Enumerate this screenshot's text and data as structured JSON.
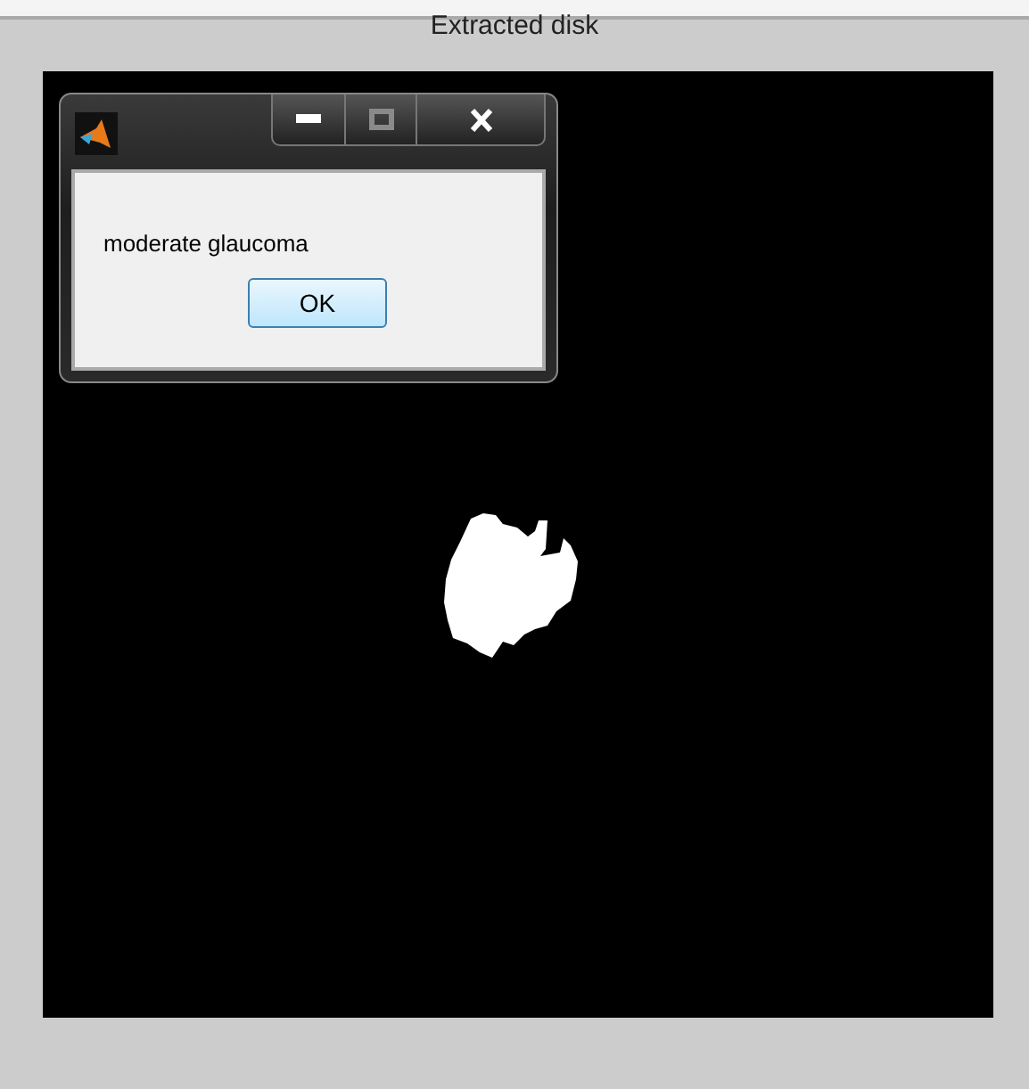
{
  "figure": {
    "title": "Extracted disk"
  },
  "dialog": {
    "message": "moderate glaucoma",
    "ok_button": "OK",
    "title_buttons": [
      {
        "kind": "minimize",
        "disabled": false
      },
      {
        "kind": "maximize",
        "disabled": true
      },
      {
        "kind": "close",
        "disabled": false
      }
    ]
  }
}
